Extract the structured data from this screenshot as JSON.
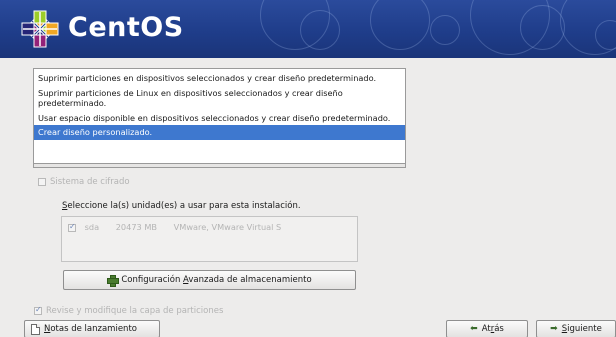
{
  "header": {
    "brand": "CentOS"
  },
  "partition_options": [
    {
      "label": "Suprimir particiones en dispositivos seleccionados y crear diseño predeterminado.",
      "selected": false
    },
    {
      "label": "Suprimir particiones de Linux en dispositivos seleccionados y crear diseño predeterminado.",
      "selected": false
    },
    {
      "label": "Usar espacio disponible en dispositivos seleccionados y crear diseño predeterminado.",
      "selected": false
    },
    {
      "label": "Crear diseño personalizado.",
      "selected": true
    }
  ],
  "encrypt": {
    "label": "Sistema de cifrado",
    "checked": false,
    "enabled": false
  },
  "drives": {
    "label_prefix": "S",
    "label_rest": "eleccione la(s) unidad(es) a usar para esta instalación.",
    "rows": [
      {
        "name": "sda",
        "size": "20473 MB",
        "model": "VMware, VMware Virtual S",
        "checked": true
      }
    ]
  },
  "advanced_button": {
    "label_before": "Configuración ",
    "label_mnemonic": "A",
    "label_after": "vanzada de almacenamiento"
  },
  "review": {
    "label": "Revise y modifique la capa de particiones",
    "checked": true,
    "enabled": false
  },
  "buttons": {
    "notes": {
      "mnemonic": "N",
      "rest": "otas de lanzamiento"
    },
    "back": {
      "before": "At",
      "mnemonic": "r",
      "after": "ás"
    },
    "next": {
      "mnemonic": "S",
      "rest": "iguiente"
    }
  },
  "colors": {
    "banner": "#1f3d8a",
    "selection": "#3e78cf",
    "background": "#edeceb"
  }
}
